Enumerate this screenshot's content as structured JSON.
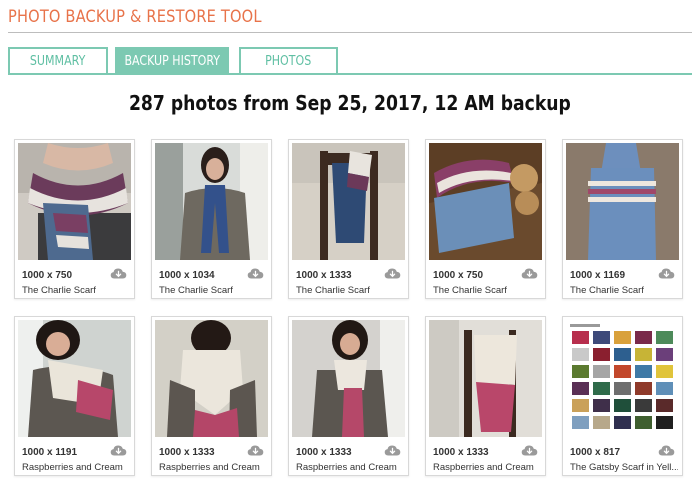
{
  "app": {
    "title": "PHOTO BACKUP & RESTORE TOOL"
  },
  "tabs": [
    {
      "label": "SUMMARY",
      "active": false
    },
    {
      "label": "BACKUP HISTORY",
      "active": true
    },
    {
      "label": "PHOTOS",
      "active": false
    }
  ],
  "heading": "287 photos from Sep 25, 2017, 12 AM backup",
  "colors": {
    "accent": "#7cc9b2",
    "title": "#e8734a"
  },
  "photos": [
    {
      "dims": "1000 x 750",
      "caption": "The Charlie Scarf"
    },
    {
      "dims": "1000 x 1034",
      "caption": "The Charlie Scarf"
    },
    {
      "dims": "1000 x 1333",
      "caption": "The Charlie Scarf"
    },
    {
      "dims": "1000 x 750",
      "caption": "The Charlie Scarf"
    },
    {
      "dims": "1000 x 1169",
      "caption": "The Charlie Scarf"
    },
    {
      "dims": "1000 x 1191",
      "caption": "Raspberries and Cream"
    },
    {
      "dims": "1000 x 1333",
      "caption": "Raspberries and Cream"
    },
    {
      "dims": "1000 x 1333",
      "caption": "Raspberries and Cream"
    },
    {
      "dims": "1000 x 1333",
      "caption": "Raspberries and Cream"
    },
    {
      "dims": "1000 x 817",
      "caption": "The Gatsby Scarf in Yell..."
    }
  ],
  "icons": {
    "download": "cloud-download-icon"
  }
}
